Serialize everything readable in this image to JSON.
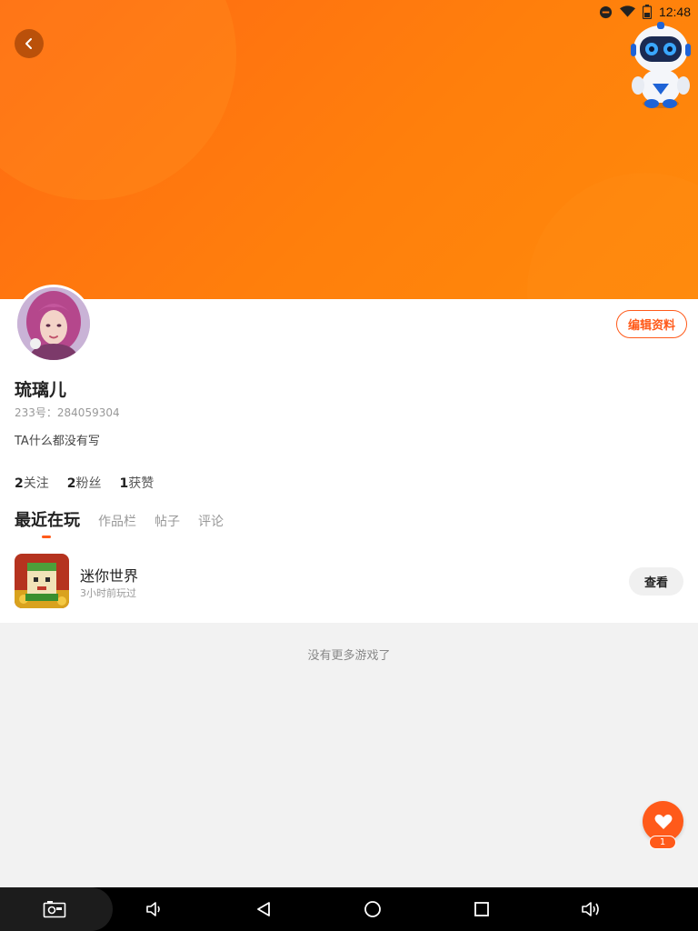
{
  "status_bar": {
    "time": "12:48",
    "icons": [
      "do-not-disturb-icon",
      "wifi-icon",
      "battery-icon"
    ]
  },
  "header": {
    "back_icon": "chevron-left-icon",
    "mascot_icon": "robot-mascot-icon"
  },
  "profile": {
    "username": "琉璃儿",
    "uid_label": "233号：284059304",
    "bio": "TA什么都没有写",
    "edit_label": "编辑资料",
    "stats": [
      {
        "count": "2",
        "label": "关注"
      },
      {
        "count": "2",
        "label": "粉丝"
      },
      {
        "count": "1",
        "label": "获赞"
      }
    ]
  },
  "tabs": [
    {
      "label": "最近在玩",
      "active": true
    },
    {
      "label": "作品栏",
      "active": false
    },
    {
      "label": "帖子",
      "active": false
    },
    {
      "label": "评论",
      "active": false
    }
  ],
  "games": [
    {
      "name": "迷你世界",
      "time": "3小时前玩过",
      "action": "查看"
    }
  ],
  "footer_text": "没有更多游戏了",
  "fab": {
    "icon": "heart-icon",
    "count": "1"
  },
  "nav_bar": {
    "icons": [
      "screenshot-icon",
      "volume-down-icon",
      "back-triangle-icon",
      "home-circle-icon",
      "recents-square-icon",
      "volume-up-icon"
    ]
  },
  "colors": {
    "accent": "#ff5a1a",
    "banner_start": "#ff6a13",
    "banner_end": "#ff8a0a"
  }
}
